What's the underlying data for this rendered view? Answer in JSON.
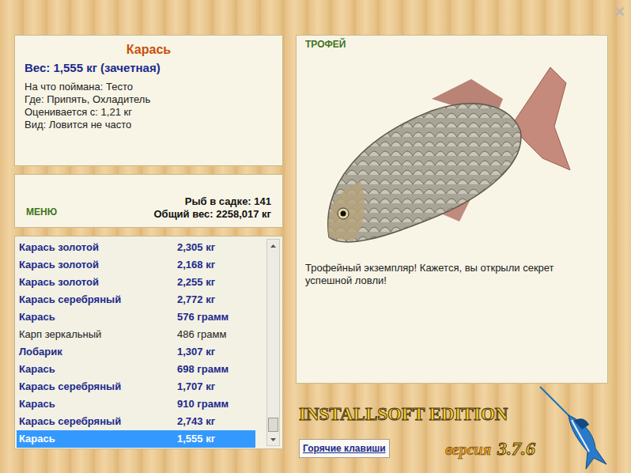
{
  "window": {
    "close": "×"
  },
  "fish_info": {
    "name": "Карась",
    "weight": "Вес: 1,555 кг (зачетная)",
    "details": [
      "На что поймана: Тесто",
      "Где: Припять, Охладитель",
      "Оценивается с: 1,21 кг",
      "Вид: Ловится не часто"
    ]
  },
  "menu": {
    "label": "МЕНЮ",
    "fish_count": "Рыб в садке: 141",
    "total_weight": "Общий вес: 2258,017 кг"
  },
  "catch_list": {
    "scroll_position": 1,
    "rows": [
      {
        "name": "Карась золотой",
        "weight": "2,305 кг",
        "bold": true,
        "selected": false
      },
      {
        "name": "Карась золотой",
        "weight": "2,168 кг",
        "bold": true,
        "selected": false
      },
      {
        "name": "Карась золотой",
        "weight": "2,255 кг",
        "bold": true,
        "selected": false
      },
      {
        "name": "Карась серебряный",
        "weight": "2,772 кг",
        "bold": true,
        "selected": false
      },
      {
        "name": "Карась",
        "weight": "576 грамм",
        "bold": true,
        "selected": false
      },
      {
        "name": "Карп зеркальный",
        "weight": "486 грамм",
        "bold": false,
        "selected": false
      },
      {
        "name": "Лобарик",
        "weight": "1,307 кг",
        "bold": true,
        "selected": false
      },
      {
        "name": "Карась",
        "weight": "698 грамм",
        "bold": true,
        "selected": false
      },
      {
        "name": "Карась серебряный",
        "weight": "1,707 кг",
        "bold": true,
        "selected": false
      },
      {
        "name": "Карась",
        "weight": "910 грамм",
        "bold": true,
        "selected": false
      },
      {
        "name": "Карась серебряный",
        "weight": "2,743 кг",
        "bold": true,
        "selected": false
      },
      {
        "name": "Карась",
        "weight": "1,555 кг",
        "bold": true,
        "selected": true
      }
    ]
  },
  "trophy": {
    "label": "ТРОФЕЙ",
    "message": "Трофейный экземпляр! Кажется, вы открыли секрет успешной ловли!"
  },
  "logo": {
    "title": "INSTALLSOFT EDITION",
    "version_label": "версия",
    "version": "3.7.6"
  },
  "buttons": [
    "Горячие клавиши"
  ]
}
